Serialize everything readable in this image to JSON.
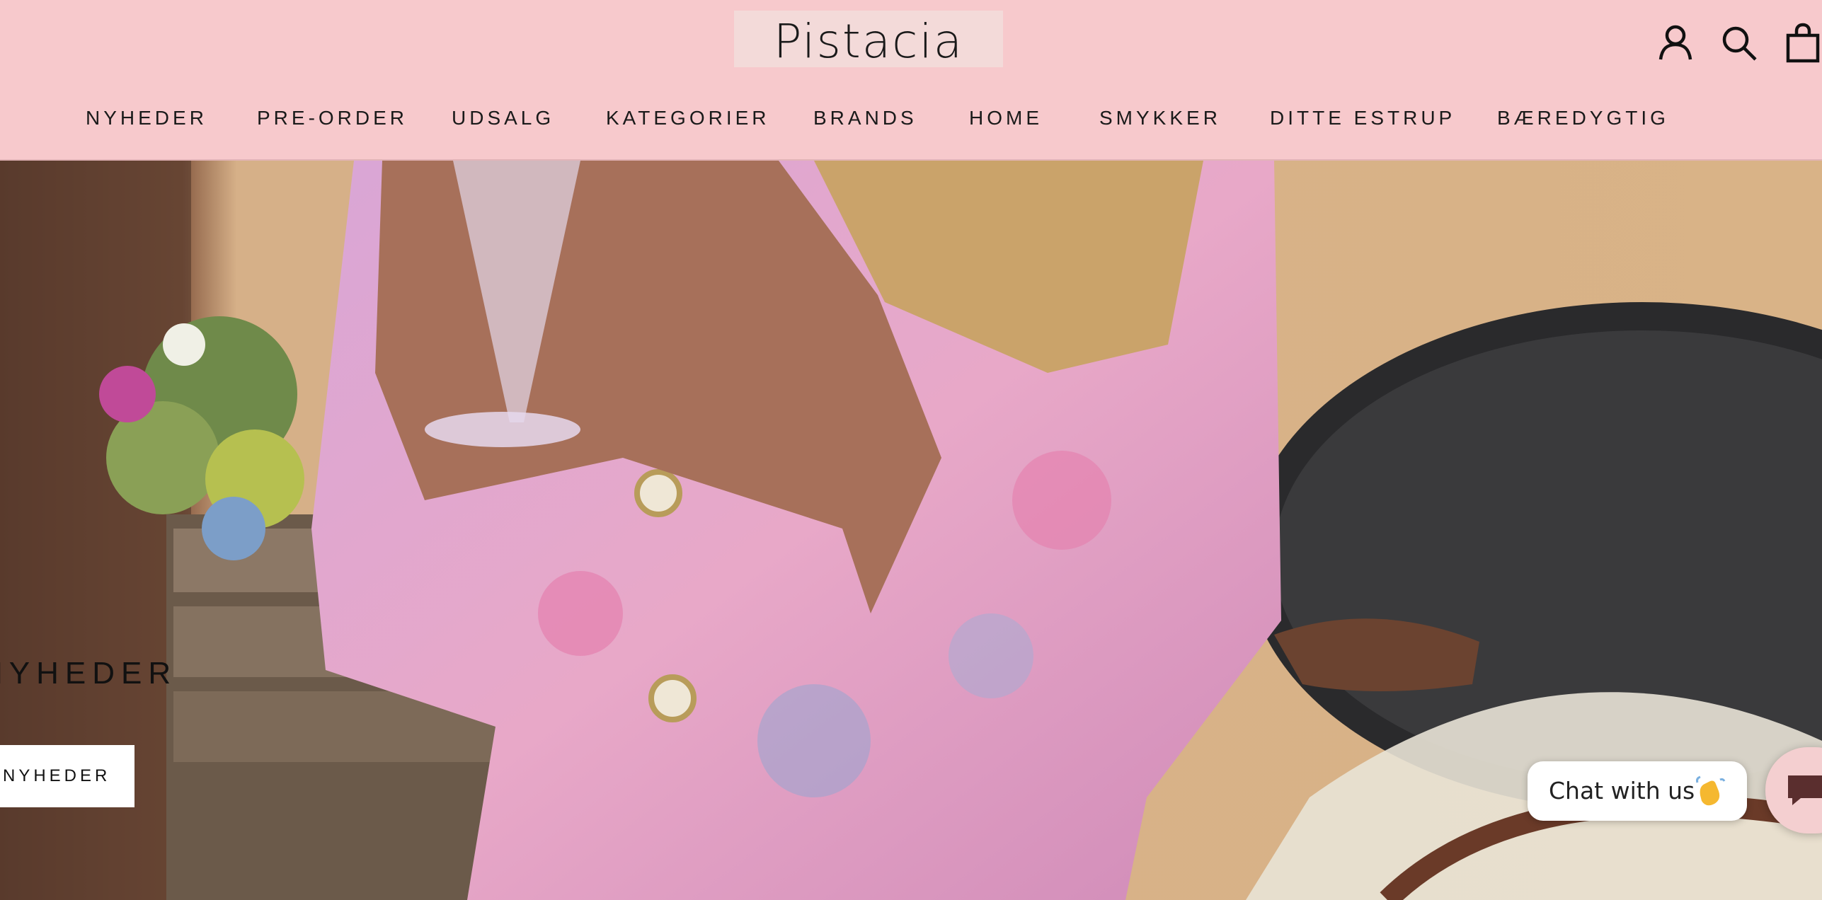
{
  "brand": {
    "name": "Pistacia",
    "header_bg": "#f7c9cc"
  },
  "header": {
    "icons": [
      "account-icon",
      "search-icon",
      "cart-icon"
    ]
  },
  "nav": {
    "items": [
      {
        "label": "NYHEDER"
      },
      {
        "label": "PRE-ORDER"
      },
      {
        "label": "UDSALG"
      },
      {
        "label": "KATEGORIER"
      },
      {
        "label": "BRANDS"
      },
      {
        "label": "HOME"
      },
      {
        "label": "SMYKKER"
      },
      {
        "label": "DITTE ESTRUP"
      },
      {
        "label": "BÆREDYGTIG"
      }
    ]
  },
  "hero": {
    "title": "NYHEDER",
    "button_label": "NYHEDER"
  },
  "chat": {
    "bubble_text": "Chat with us",
    "emoji": "waving-hand-icon",
    "launcher_icon": "chat-icon"
  }
}
